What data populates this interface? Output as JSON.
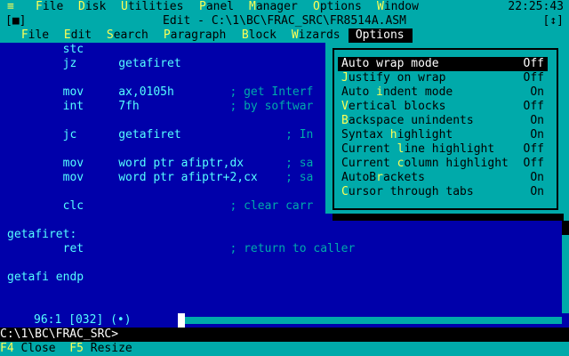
{
  "topbar": {
    "system_glyph": "≡",
    "items": [
      {
        "hk": "F",
        "rest": "ile"
      },
      {
        "hk": "D",
        "rest": "isk"
      },
      {
        "hk": "U",
        "rest": "tilities"
      },
      {
        "hk": "P",
        "rest": "anel"
      },
      {
        "hk": "M",
        "rest": "anager"
      },
      {
        "hk": "O",
        "rest": "ptions"
      },
      {
        "hk": "W",
        "rest": "indow"
      }
    ],
    "clock": "22:25:43"
  },
  "editor": {
    "title": "Edit - C:\\1\\BC\\FRAC_SRC\\FR8514A.ASM",
    "box_left": "[■]",
    "box_right": "[↕]",
    "menu": [
      {
        "hk": "F",
        "rest": "ile"
      },
      {
        "hk": "E",
        "rest": "dit"
      },
      {
        "hk": "S",
        "rest": "earch"
      },
      {
        "hk": "P",
        "rest": "aragraph"
      },
      {
        "hk": "B",
        "rest": "lock"
      },
      {
        "hk": "W",
        "rest": "izards"
      },
      {
        "hk": "O",
        "rest": "ptions"
      }
    ],
    "code_lines": [
      {
        "code": "        stc",
        "comment": ""
      },
      {
        "code": "        jz      getafiret",
        "comment": ""
      },
      {
        "code": "",
        "comment": ""
      },
      {
        "code": "        mov     ax,0105h        ",
        "comment": "; get Interf"
      },
      {
        "code": "        int     7fh             ",
        "comment": "; by softwar"
      },
      {
        "code": "",
        "comment": ""
      },
      {
        "code": "        jc      getafiret               ",
        "comment": "; In"
      },
      {
        "code": "",
        "comment": ""
      },
      {
        "code": "        mov     word ptr afiptr,dx      ",
        "comment": "; sa"
      },
      {
        "code": "        mov     word ptr afiptr+2,cx    ",
        "comment": "; sa"
      },
      {
        "code": "",
        "comment": ""
      },
      {
        "code": "        clc                     ",
        "comment": "; clear carr"
      },
      {
        "code": "",
        "comment": ""
      },
      {
        "code": "getafiret:",
        "comment": ""
      },
      {
        "code": "        ret                     ",
        "comment": "; return to caller"
      },
      {
        "code": "",
        "comment": ""
      },
      {
        "code": "getafi endp",
        "comment": ""
      }
    ],
    "cursor_pos": "96:1 [032] (•)"
  },
  "options_menu": {
    "items": [
      {
        "pre": "",
        "hk": "A",
        "rest": "uto wrap mode",
        "value": "Off"
      },
      {
        "pre": "",
        "hk": "J",
        "rest": "ustify on wrap",
        "value": "Off"
      },
      {
        "pre": "Auto ",
        "hk": "i",
        "rest": "ndent mode",
        "value": "On"
      },
      {
        "pre": "",
        "hk": "V",
        "rest": "ertical blocks",
        "value": "Off"
      },
      {
        "pre": "",
        "hk": "B",
        "rest": "ackspace unindents",
        "value": "On"
      },
      {
        "pre": "Syntax ",
        "hk": "h",
        "rest": "ighlight",
        "value": "On"
      },
      {
        "pre": "Current ",
        "hk": "l",
        "rest": "ine highlight",
        "value": "Off"
      },
      {
        "pre": "Current ",
        "hk": "c",
        "rest": "olumn highlight",
        "value": "Off"
      },
      {
        "pre": "AutoB",
        "hk": "r",
        "rest": "ackets",
        "value": "On"
      },
      {
        "pre": "",
        "hk": "C",
        "rest": "ursor through tabs",
        "value": "On"
      }
    ]
  },
  "prompt": "C:\\1\\BC\\FRAC_SRC>",
  "fkeys": [
    {
      "key": "F4",
      "label": "Close"
    },
    {
      "key": "F5",
      "label": "Resize"
    }
  ]
}
